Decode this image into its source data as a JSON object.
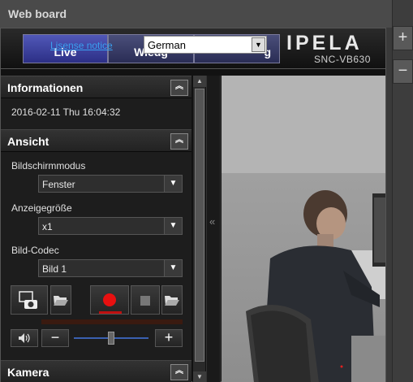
{
  "board": {
    "title": "Web board",
    "zoom_in": "+",
    "zoom_out": "−"
  },
  "header": {
    "tabs": [
      "Live",
      "Wiedg",
      "g"
    ],
    "license_link": "Lisense notice",
    "language": "German",
    "brand": "IPELA",
    "model": "SNC-VB630"
  },
  "panel": {
    "informationen": {
      "title": "Informationen",
      "datetime": "2016-02-11 Thu 16:04:32"
    },
    "ansicht": {
      "title": "Ansicht",
      "bildschirmmodus_label": "Bildschirmmodus",
      "bildschirmmodus_value": "Fenster",
      "anzeigegroesse_label": "Anzeigegröße",
      "anzeigegroesse_value": "x1",
      "codec_label": "Bild-Codec",
      "codec_value": "Bild 1"
    },
    "kamera": {
      "title": "Kamera"
    }
  },
  "volume": {
    "minus": "−",
    "plus": "+",
    "level": 0.5
  },
  "icons": {
    "collapse": "double-chevron-up-icon",
    "expand_panel": "double-chevron-left-icon",
    "snapshot": "camera-icon",
    "folder": "folder-open-icon",
    "record": "record-icon",
    "stop": "stop-icon",
    "speaker": "speaker-icon"
  },
  "colors": {
    "record": "#e81010",
    "tab_active": "#3a40a0",
    "link": "#3aa0f0"
  }
}
